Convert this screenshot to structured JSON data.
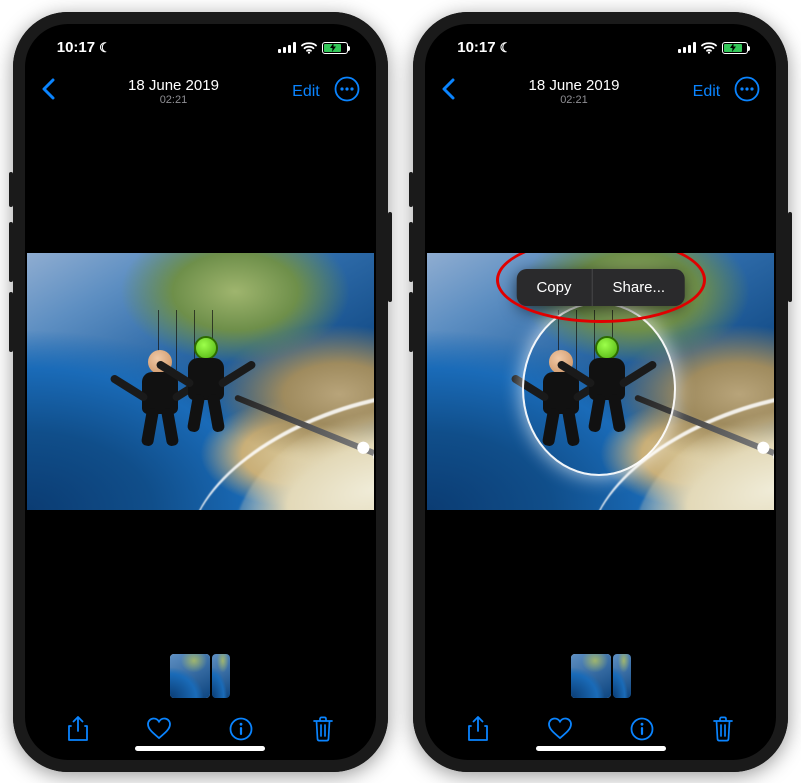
{
  "status": {
    "time": "10:17",
    "dnd_icon": "moon-icon",
    "battery_state": "charging"
  },
  "nav": {
    "date": "18 June 2019",
    "time": "02:21",
    "edit_label": "Edit"
  },
  "context_menu": {
    "copy": "Copy",
    "share": "Share..."
  },
  "colors": {
    "accent": "#0a84ff",
    "annotation": "#e00000",
    "battery": "#34c759"
  },
  "thumbnails": {
    "count_full": 1,
    "count_partial": 1
  },
  "screens": [
    {
      "show_context_menu": false,
      "show_subject_glow": false,
      "show_annotation": false
    },
    {
      "show_context_menu": true,
      "show_subject_glow": true,
      "show_annotation": true
    }
  ]
}
